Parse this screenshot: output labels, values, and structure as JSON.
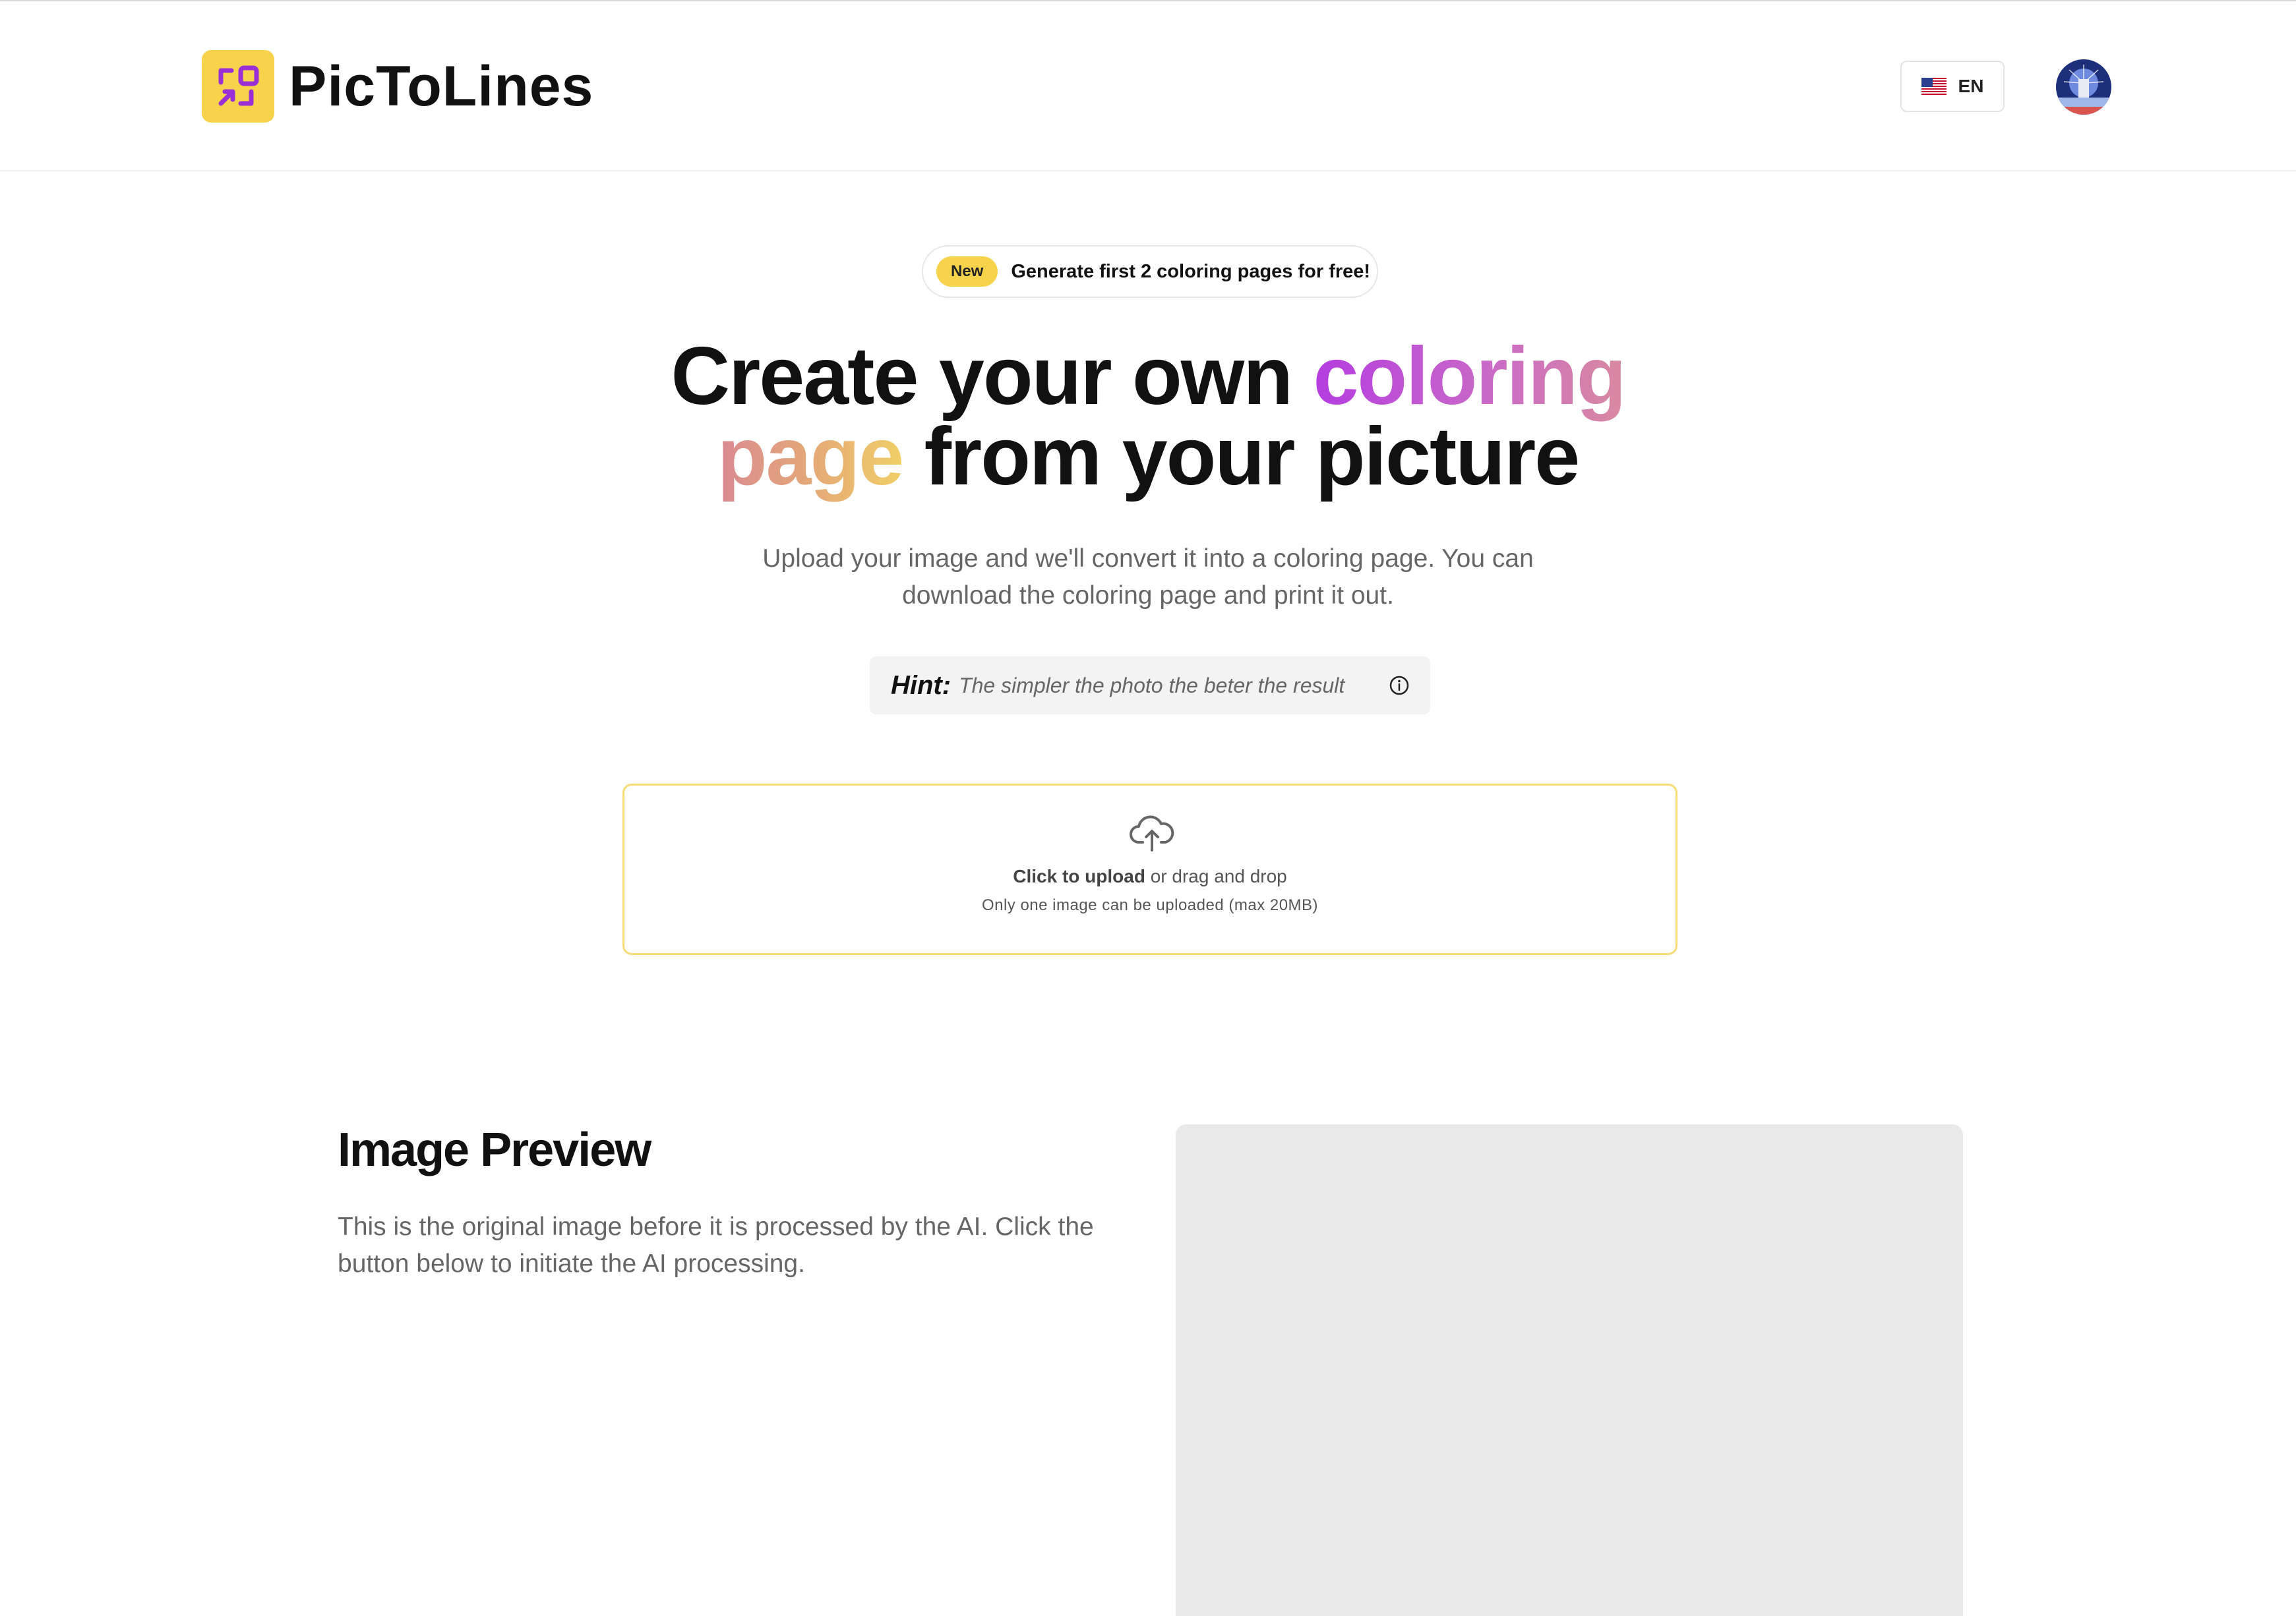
{
  "header": {
    "logo_text": "PicToLines",
    "language": "EN"
  },
  "badge": {
    "tag": "New",
    "text": "Generate first 2 coloring pages for free!"
  },
  "hero": {
    "title_part1": "Create your own ",
    "title_highlight1": "coloring",
    "title_highlight2": "page",
    "title_part2": " from your picture",
    "subtitle": "Upload your image and we'll convert it into a coloring page. You can download the coloring page and print it out."
  },
  "hint": {
    "label": "Hint:",
    "text": "The simpler the photo the beter the result"
  },
  "upload": {
    "click_label": "Click to upload",
    "drag_label": " or drag and drop",
    "note": "Only one image can be uploaded (max 20MB)"
  },
  "preview": {
    "title": "Image Preview",
    "description": "This is the original image before it is processed by the AI. Click the button below to initiate the AI processing."
  },
  "colors": {
    "brand_yellow": "#f7d34c",
    "brand_purple": "#a035d8",
    "upload_border": "#f5dc78",
    "preview_bg": "#e9e9e9"
  },
  "icons": {
    "logo": "expand-arrows-icon",
    "flag": "us-flag-icon",
    "hint": "info-icon",
    "upload": "cloud-upload-icon"
  }
}
